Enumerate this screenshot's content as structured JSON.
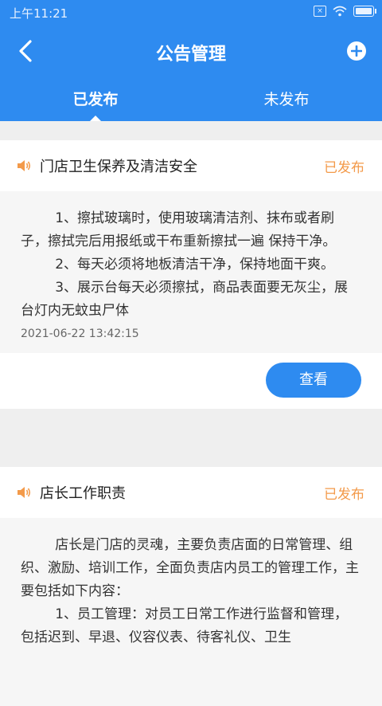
{
  "status_bar": {
    "time": "上午11:21"
  },
  "navbar": {
    "title": "公告管理"
  },
  "tabs": [
    {
      "label": "已发布",
      "active": true
    },
    {
      "label": "未发布",
      "active": false
    }
  ],
  "notices": [
    {
      "title": "门店卫生保养及清洁安全",
      "status": "已发布",
      "content": "        1、擦拭玻璃时，使用玻璃清洁剂、抹布或者刷子，擦拭完后用报纸或干布重新擦拭一遍 保持干净。\n        2、每天必须将地板清洁干净，保持地面干爽。\n        3、展示台每天必须擦拭，商品表面要无灰尘，展台灯内无蚊虫尸体",
      "time": "2021-06-22 13:42:15",
      "button": "查看"
    },
    {
      "title": "店长工作职责",
      "status": "已发布",
      "content": "        店长是门店的灵魂，主要负责店面的日常管理、组织、激励、培训工作，全面负责店内员工的管理工作，主要包括如下内容：\n        1、员工管理：对员工日常工作进行监督和管理，包括迟到、早退、仪容仪表、待客礼仪、卫生"
    }
  ],
  "colors": {
    "primary": "#2e8bf0",
    "status": "#f39a4a",
    "speaker": "#f39a4a"
  }
}
